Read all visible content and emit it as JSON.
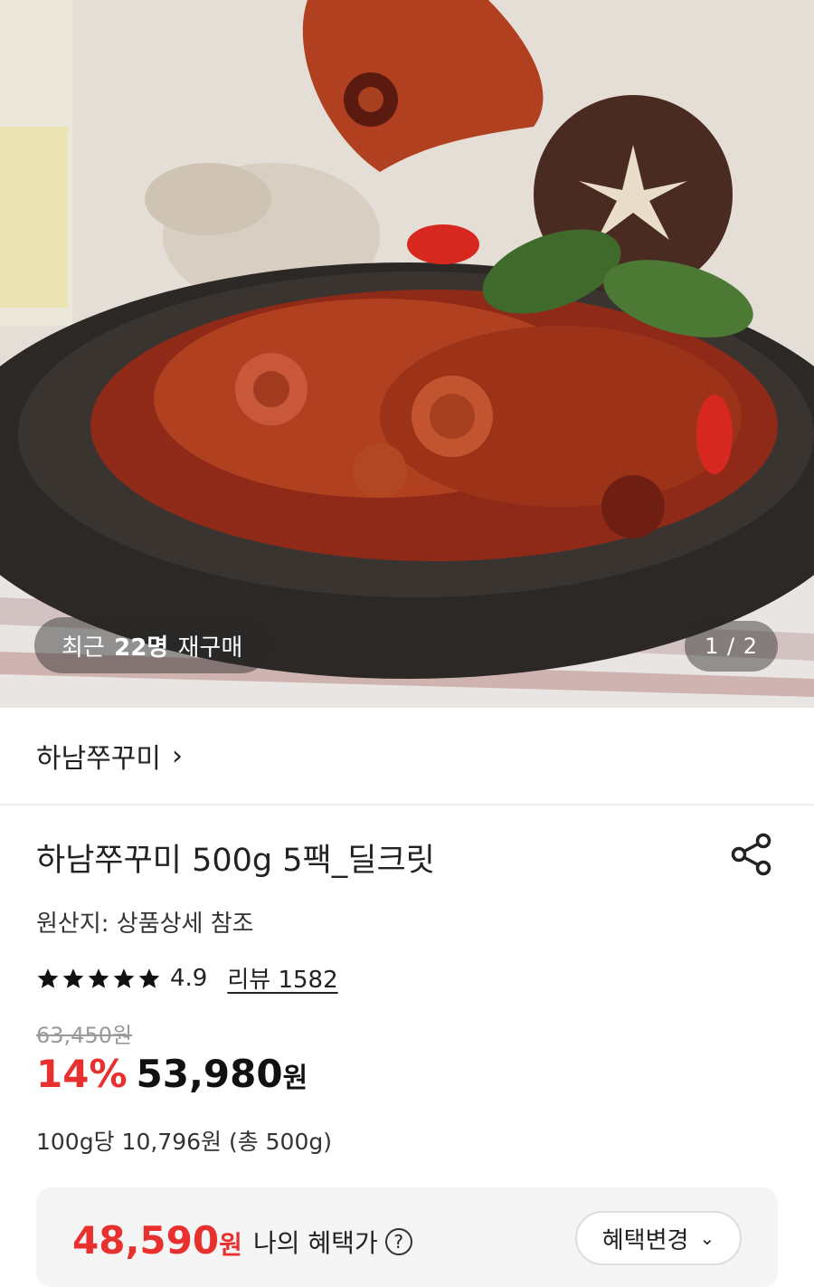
{
  "hero": {
    "image_alt": "octopus stir-fry in cast iron pan",
    "repurchase_prefix": "최근",
    "repurchase_count": "22명",
    "repurchase_suffix": "재구매",
    "page_current": "1",
    "page_total": "2"
  },
  "brand": {
    "name": "하남쭈꾸미",
    "chevron": "›"
  },
  "product": {
    "title": "하남쭈꾸미 500g 5팩_딜크릿",
    "origin": "원산지: 상품상세 참조",
    "rating": "4.9",
    "rating_stars": 5,
    "review_label": "리뷰 1582",
    "original_price": "63,450원",
    "discount": "14%",
    "price": "53,980",
    "currency": "원",
    "unit_price": "100g당 10,796원 (총 500g)"
  },
  "benefit": {
    "price": "48,590",
    "currency": "원",
    "label": "나의 혜택가",
    "help_icon": "?",
    "change_label": "혜택변경",
    "change_chevron": "⌄"
  },
  "colors": {
    "accent": "#e8312f"
  }
}
